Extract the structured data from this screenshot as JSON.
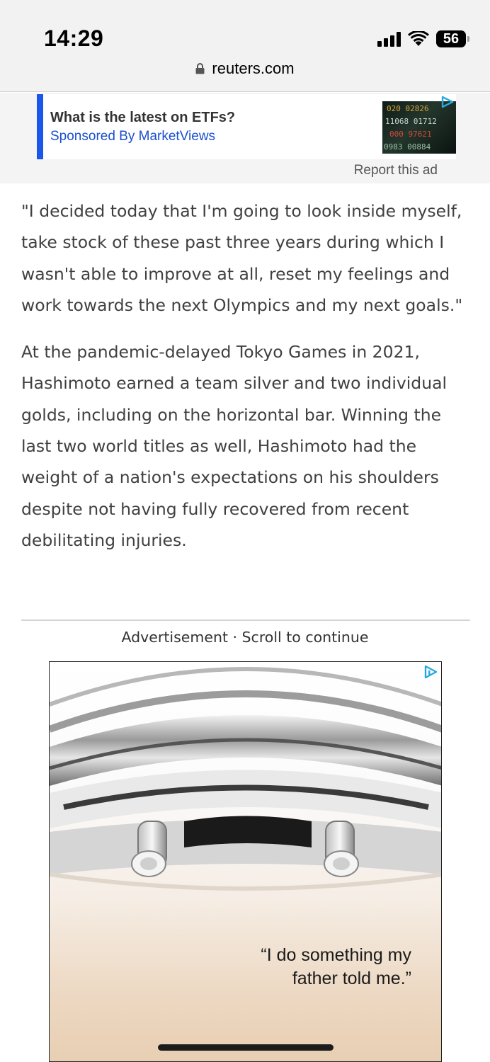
{
  "status_bar": {
    "time": "14:29",
    "battery_level": "56"
  },
  "browser": {
    "url": "reuters.com"
  },
  "top_ad": {
    "title": "What is the latest on ETFs?",
    "sponsor": "Sponsored By MarketViews",
    "report_label": "Report this ad",
    "accent_color": "#1a57e8"
  },
  "article": {
    "paragraphs": [
      "\"I decided today that I'm going to look inside myself, take stock of these past three years during which I wasn't able to improve at all, reset my feelings and work towards the next Olympics and my next goals.\"",
      "At the pandemic-delayed Tokyo Games in 2021, Hashimoto earned a team silver and two individual golds, including on the horizontal bar. Winning the last two world titles as well, Hashimoto had the weight of a nation's expectations on his shoulders despite not having fully recovered from recent debilitating injuries."
    ]
  },
  "inline_ad": {
    "label": "Advertisement · Scroll to continue",
    "quote_line1": "“I do something my",
    "quote_line2": "father told me.”"
  }
}
